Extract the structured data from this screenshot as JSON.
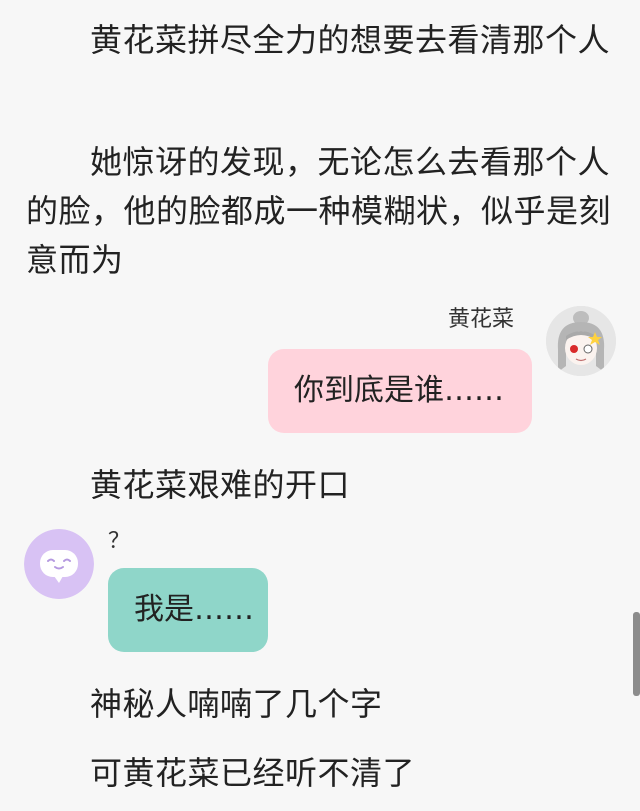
{
  "story": {
    "p1": "黄花菜拼尽全力的想要去看清那个人",
    "p2": "她惊讶的发现，无论怎么去看那个人的脸，他的脸都成一种模糊状，似乎是刻意而为",
    "p3": "黄花菜艰难的开口",
    "p4": "神秘人喃喃了几个字",
    "p5": "可黄花菜已经听不清了"
  },
  "chat": {
    "right": {
      "name": "黄花菜",
      "message": "你到底是谁……",
      "bubble_color": "#ffd3dc",
      "avatar_icon": "gray-haired-anime-girl-avatar"
    },
    "left": {
      "name": "？",
      "message": "我是……",
      "bubble_color": "#8fd6c9",
      "avatar_color": "#d8c2f4",
      "avatar_icon": "chat-bubble-face-icon"
    }
  }
}
